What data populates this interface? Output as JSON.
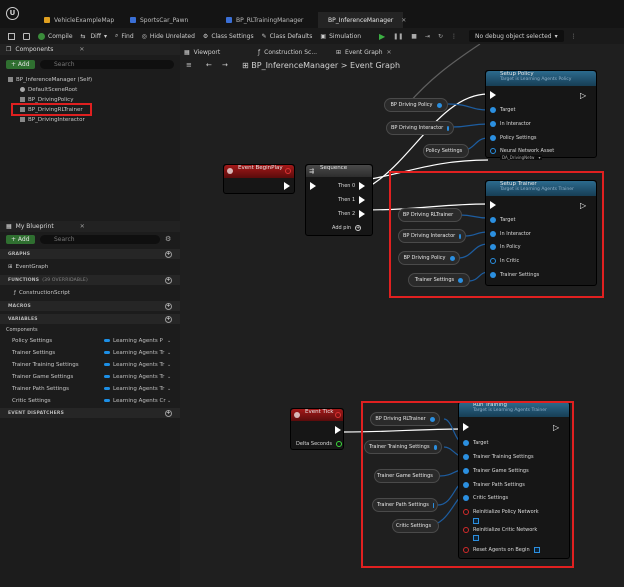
{
  "tabs": [
    {
      "label": "VehicleExampleMap",
      "active": false
    },
    {
      "label": "SportsCar_Pawn",
      "active": false
    },
    {
      "label": "BP_RLTrainingManager",
      "active": false
    },
    {
      "label": "BP_InferenceManager",
      "active": true
    }
  ],
  "toolbar": {
    "compile": "Compile",
    "diff": "Diff",
    "find": "Find",
    "hide_unrelated": "Hide Unrelated",
    "class_settings": "Class Settings",
    "class_defaults": "Class Defaults",
    "simulation": "Simulation",
    "debug_object": "No debug object selected"
  },
  "components_panel": {
    "title": "Components",
    "add_label": "+ Add",
    "search_placeholder": "Search",
    "items": [
      "BP_InferenceManager (Self)",
      "DefaultSceneRoot",
      "BP_DrivingPolicy",
      "BP_DrivingRLTrainer",
      "BP_DrivingInteractor"
    ]
  },
  "blueprint_panel": {
    "title": "My Blueprint",
    "add_label": "+ Add",
    "search_placeholder": "Search",
    "sections": {
      "graphs": "GRAPHS",
      "event_graph": "EventGraph",
      "functions": "FUNCTIONS",
      "functions_count": "(39 OVERRIDABLE)",
      "construction_script": "ConstructionScript",
      "macros": "MACROS",
      "variables": "VARIABLES",
      "components": "Components",
      "event_dispatchers": "EVENT DISPATCHERS"
    },
    "variables": [
      {
        "name": "Policy Settings",
        "type": "Learning Agents P"
      },
      {
        "name": "Trainer Settings",
        "type": "Learning Agents Tr"
      },
      {
        "name": "Trainer Training Settings",
        "type": "Learning Agents Tr"
      },
      {
        "name": "Trainer Game Settings",
        "type": "Learning Agents Tr"
      },
      {
        "name": "Trainer Path Settings",
        "type": "Learning Agents Tr"
      },
      {
        "name": "Critic Settings",
        "type": "Learning Agents Cr"
      }
    ]
  },
  "graph": {
    "tabs": [
      "Viewport",
      "Construction Sc...",
      "Event Graph"
    ],
    "breadcrumb": "BP_InferenceManager > Event Graph",
    "setup_policy": {
      "title": "Setup Policy",
      "subtitle": "Target is Learning Agents Policy",
      "pins": [
        "Target",
        "In Interactor",
        "Policy Settings",
        "Neural Network Asset",
        "DA_DrivingNetw"
      ]
    },
    "setup_trainer": {
      "title": "Setup Trainer",
      "subtitle": "Target is Learning Agents Trainer",
      "pins": [
        "Target",
        "In Interactor",
        "In Policy",
        "In Critic",
        "Trainer Settings"
      ]
    },
    "run_training": {
      "title": "Run Training",
      "subtitle": "Target is Learning Agents Trainer",
      "pins": [
        "Target",
        "Trainer Training Settings",
        "Trainer Game Settings",
        "Trainer Path Settings",
        "Critic Settings",
        "Reinitialize Policy Network",
        "Reinitialize Critic Network",
        "Reset Agents on Begin"
      ]
    },
    "sequence": {
      "title": "Sequence",
      "pins": [
        "Then 0",
        "Then 1",
        "Then 2",
        "Add pin"
      ]
    },
    "event_begin_play": "Event BeginPlay",
    "event_tick": "Event Tick",
    "delta_seconds": "Delta Seconds",
    "getters": {
      "bp_driving_policy": "BP Driving Policy",
      "bp_driving_interactor": "BP Driving Interactor",
      "policy_settings": "Policy Settings",
      "bp_driving_rltrainer": "BP Driving RLTrainer",
      "trainer_settings": "Trainer Settings",
      "trainer_training_settings": "Trainer Training Settings",
      "trainer_game_settings": "Trainer Game Settings",
      "trainer_path_settings": "Trainer Path Settings",
      "critic_settings": "Critic Settings"
    }
  },
  "colors": {
    "accent_blue": "#2b8fe0",
    "highlight_red": "#e02020",
    "function_header": "#1e4f6b",
    "event_header": "#8a1111",
    "sequence_header": "#3d3d3d"
  }
}
